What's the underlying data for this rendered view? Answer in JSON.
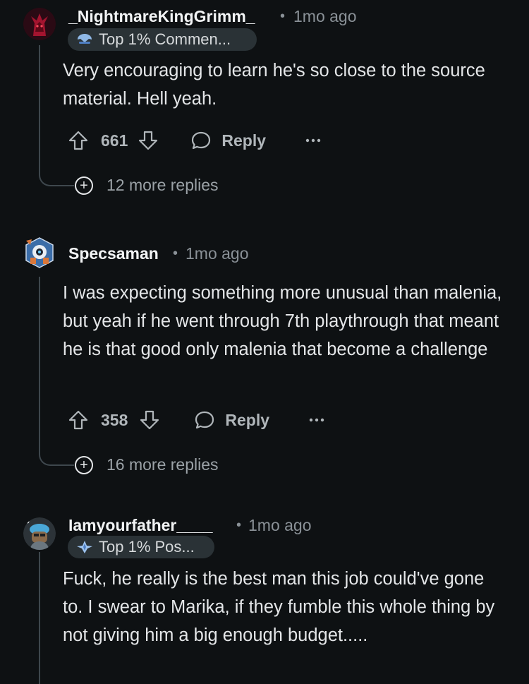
{
  "comments": [
    {
      "username": "_NightmareKingGrimm_",
      "time": "1mo ago",
      "badge": "Top 1% Commen...",
      "text": "Very encouraging to learn he's so close to the source material. Hell yeah.",
      "votes": "661",
      "reply_label": "Reply",
      "more_replies": "12 more replies"
    },
    {
      "username": "Specsaman",
      "time": "1mo ago",
      "text": "I was expecting something more unusual than malenia, but yeah if he went through 7th playthrough that meant he is that good only malenia that become a challenge",
      "votes": "358",
      "reply_label": "Reply",
      "more_replies": "16 more replies"
    },
    {
      "username": "Iamyourfather____",
      "time": "1mo ago",
      "badge": "Top 1% Pos...",
      "text": "Fuck, he really is the best man this job could've gone to. I swear to Marika, if they fumble this whole thing by not giving him a big enough budget....."
    }
  ],
  "separator": "•",
  "icons": {
    "upvote": "upvote-arrow-icon",
    "downvote": "downvote-arrow-icon",
    "reply": "speech-bubble-icon",
    "overflow": "ellipsis-icon",
    "expand": "plus-circle-icon"
  }
}
